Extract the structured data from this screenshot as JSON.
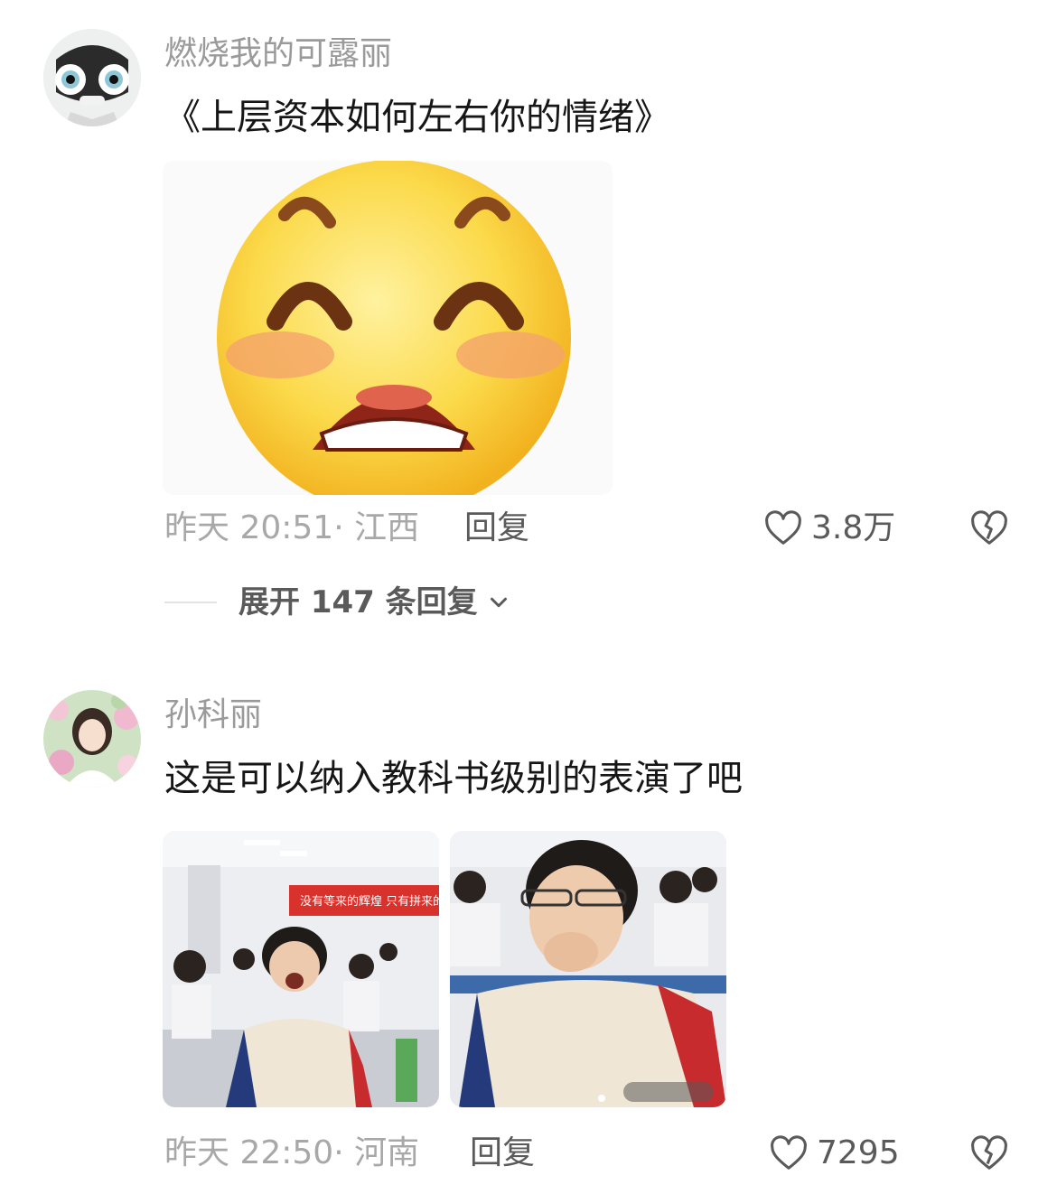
{
  "comments": [
    {
      "username": "燃烧我的可露丽",
      "text": "《上层资本如何左右你的情绪》",
      "time_location": "昨天 20:51· 江西",
      "reply_label": "回复",
      "like_count": "3.8万",
      "expand_label": "展开 147 条回复"
    },
    {
      "username": "孙科丽",
      "text": "这是可以纳入教科书级别的表演了吧",
      "banner_text": "没有等来的辉煌 只有拼来的精",
      "time_location": "昨天 22:50· 河南",
      "reply_label": "回复",
      "like_count": "7295"
    }
  ],
  "icons": {
    "like": "heart-outline-icon",
    "dislike": "broken-heart-icon",
    "expand": "chevron-down-icon"
  },
  "colors": {
    "username": "#9a9a9a",
    "text": "#161616",
    "meta": "#a8a8a8",
    "action": "#5a5a5a"
  }
}
